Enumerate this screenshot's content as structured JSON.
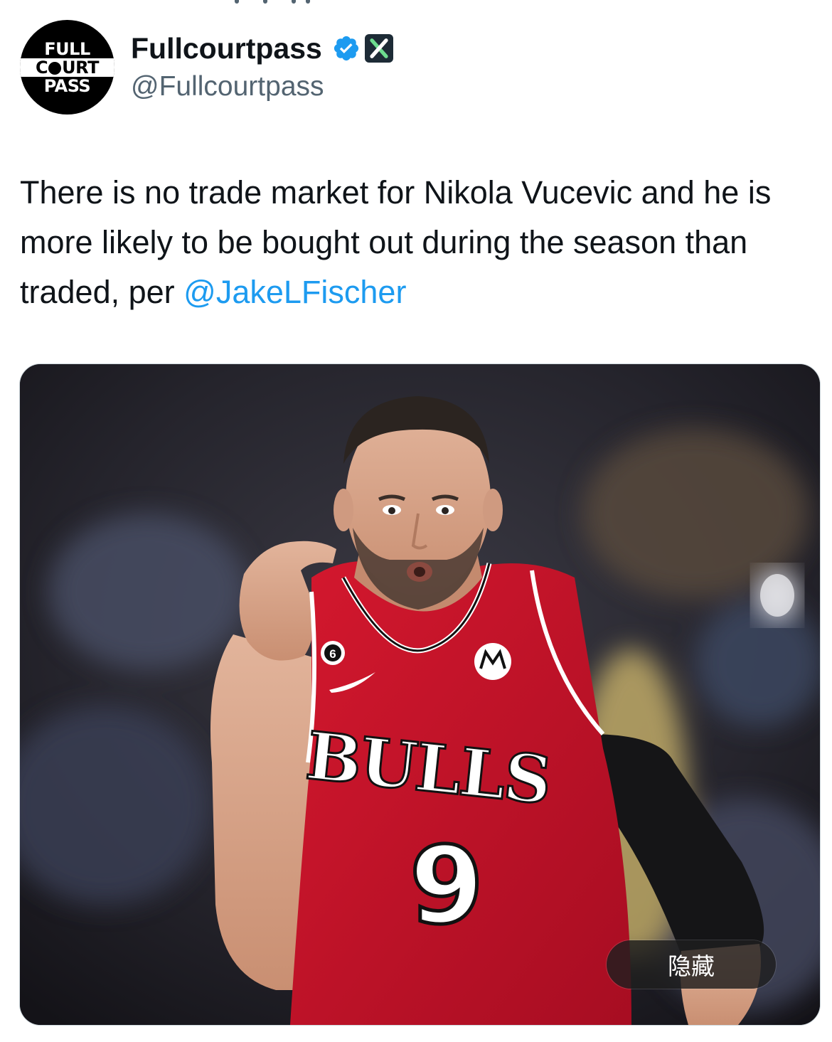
{
  "post": {
    "author": {
      "display_name": "Fullcourtpass",
      "handle": "@Fullcourtpass",
      "avatar_lines": [
        "FULL",
        "COURT",
        "PASS"
      ],
      "badges": [
        "verified-icon",
        "x-badge-icon"
      ]
    },
    "text": {
      "body": "There is no trade market for Nikola Vucevic and he is more likely to be bought out during the season than traded, per ",
      "mention": "@JakeLFischer"
    },
    "media": {
      "type": "photo",
      "jersey_patch": "6",
      "jersey_wordmark": "BULLS",
      "jersey_number": "9",
      "hide_label": "隐藏"
    }
  },
  "colors": {
    "link": "#1d9bf0",
    "secondary_text": "#536471",
    "verified": "#1d9bf0",
    "jersey_red": "#c8102e"
  }
}
